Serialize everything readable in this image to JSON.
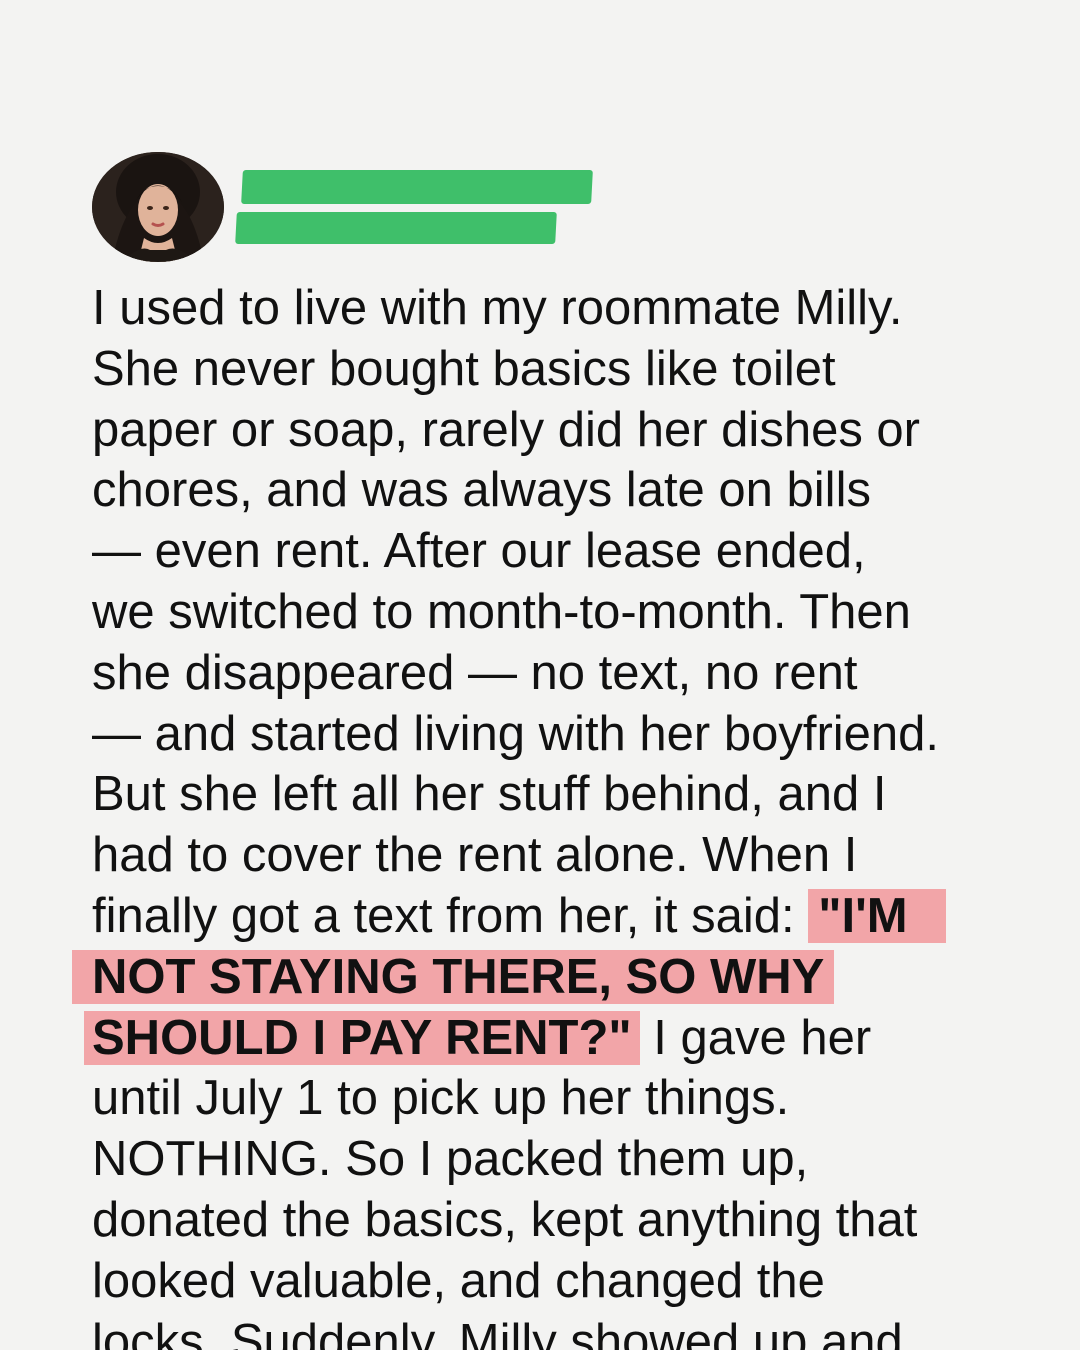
{
  "post": {
    "author": {
      "avatar_icon": "profile-photo"
    },
    "redaction_color": "#3fbf6a",
    "highlight_color": "#f2a5a8",
    "lines": [
      "I used to live with my roommate Milly.",
      "She never bought basics like toilet",
      "paper or soap, rarely did her dishes or",
      "chores, and was always late on bills",
      "— even rent. After our lease ended,",
      "we switched to month-to-month. Then",
      "she disappeared — no text, no rent",
      "— and started living with her boyfriend.",
      "But she left all her stuff behind, and I",
      "had to cover the rent alone. When I",
      "finally got a text from her, it said: ",
      "",
      "",
      " I gave her",
      "until July 1 to pick up her things.",
      "NOTHING. So I packed them up,",
      "donated the basics, kept anything that",
      "looked valuable, and changed the",
      "locks. Suddenly, Milly showed up and"
    ],
    "highlights": [
      "\"I'M",
      "NOT STAYING THERE, SO WHY",
      "SHOULD I PAY RENT?\""
    ]
  }
}
